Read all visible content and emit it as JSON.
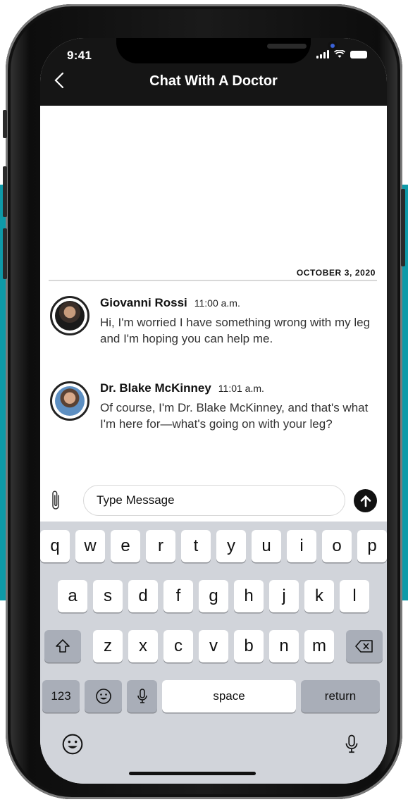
{
  "status_bar": {
    "time": "9:41"
  },
  "header": {
    "title": "Chat With A Doctor",
    "back_icon": "chevron-left-icon"
  },
  "chat": {
    "date": "OCTOBER 3, 2020",
    "messages": [
      {
        "name": "Giovanni Rossi",
        "time": "11:00 a.m.",
        "text": "Hi, I'm worried I have something wrong with my leg and I'm hoping you can help me."
      },
      {
        "name": "Dr. Blake McKinney",
        "time": "11:01 a.m.",
        "text": "Of course, I'm Dr. Blake McKinney, and that's what I'm here for—what's going on with your leg?"
      }
    ]
  },
  "composer": {
    "placeholder": "Type Message",
    "attach_icon": "paperclip-icon",
    "send_icon": "arrow-up-circle-icon"
  },
  "keyboard": {
    "row1": [
      "q",
      "w",
      "e",
      "r",
      "t",
      "y",
      "u",
      "i",
      "o",
      "p"
    ],
    "row2": [
      "a",
      "s",
      "d",
      "f",
      "g",
      "h",
      "j",
      "k",
      "l"
    ],
    "row3": [
      "z",
      "x",
      "c",
      "v",
      "b",
      "n",
      "m"
    ],
    "numbers": "123",
    "space": "space",
    "return": "return"
  },
  "colors": {
    "accent_band": "#0e9aa8",
    "header": "#151515",
    "keyboard": "#d1d4da"
  }
}
